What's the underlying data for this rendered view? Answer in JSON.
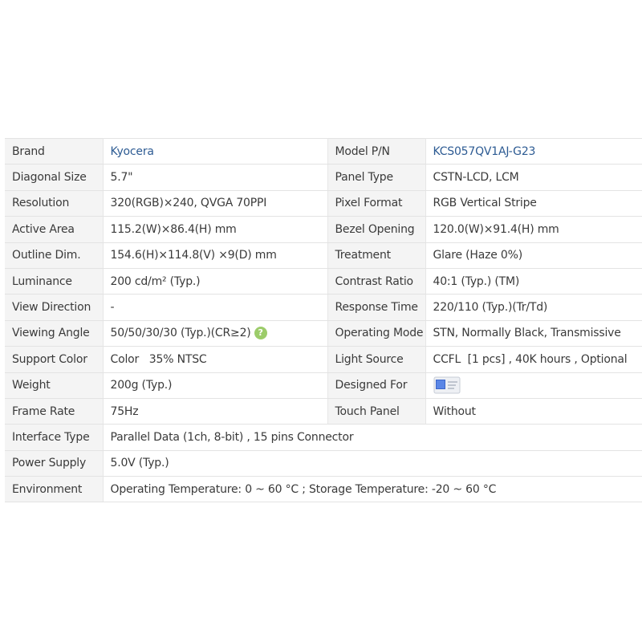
{
  "specs": {
    "rows": [
      {
        "l1": "Brand",
        "v1": "Kyocera",
        "l2": "Model P/N",
        "v2": "KCS057QV1AJ-G23"
      },
      {
        "l1": "Diagonal Size",
        "v1": "5.7\"",
        "l2": "Panel Type",
        "v2": "CSTN-LCD, LCM"
      },
      {
        "l1": "Resolution",
        "v1": "320(RGB)×240, QVGA  70PPI",
        "l2": "Pixel Format",
        "v2": "RGB Vertical Stripe"
      },
      {
        "l1": "Active Area",
        "v1": "115.2(W)×86.4(H) mm",
        "l2": "Bezel Opening",
        "v2": "120.0(W)×91.4(H) mm"
      },
      {
        "l1": "Outline Dim.",
        "v1": "154.6(H)×114.8(V) ×9(D) mm",
        "l2": "Treatment",
        "v2": "Glare (Haze 0%)"
      },
      {
        "l1": "Luminance",
        "v1": "200 cd/m² (Typ.)",
        "l2": "Contrast Ratio",
        "v2": "40:1 (Typ.) (TM)"
      },
      {
        "l1": "View Direction",
        "v1": "-",
        "l2": "Response Time",
        "v2": "220/110 (Typ.)(Tr/Td)"
      },
      {
        "l1": "Viewing Angle",
        "v1": "50/50/30/30 (Typ.)(CR≥2)",
        "l2": "Operating Mode",
        "v2": "STN, Normally Black, Transmissive"
      },
      {
        "l1": "Support Color",
        "v1": "Color   35% NTSC",
        "l2": "Light Source",
        "v2": "CCFL  [1 pcs] , 40K hours , Optional"
      },
      {
        "l1": "Weight",
        "v1": "200g (Typ.)",
        "l2": "Designed For",
        "v2": ""
      },
      {
        "l1": "Frame Rate",
        "v1": "75Hz",
        "l2": "Touch Panel",
        "v2": "Without"
      }
    ],
    "wide_rows": [
      {
        "label": "Interface Type",
        "value": "Parallel Data (1ch, 8-bit) , 15 pins Connector"
      },
      {
        "label": "Power Supply",
        "value": "5.0V (Typ.)"
      },
      {
        "label": "Environment",
        "value": "Operating Temperature: 0 ~ 60 °C ; Storage Temperature: -20 ~ 60 °C"
      }
    ],
    "help_icon_glyph": "?",
    "designed_for_icon": "industrial-device-icon"
  },
  "colors": {
    "link": "#2d5b93",
    "label_bg": "#f4f4f4",
    "help_icon": "#9ccc6a"
  }
}
